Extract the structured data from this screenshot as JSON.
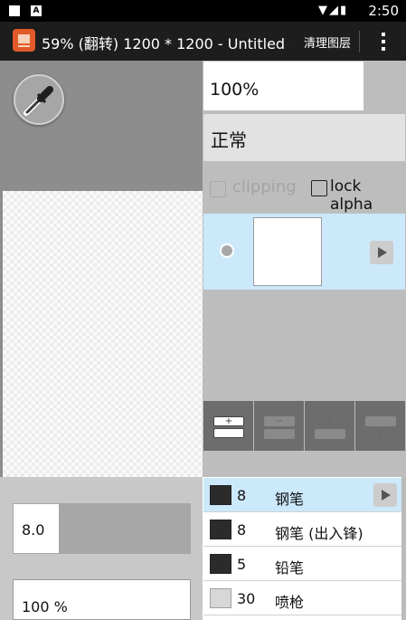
{
  "status_bar": {
    "time": "2:50",
    "notification_icon": "A",
    "icons": [
      "wifi-icon",
      "signal-icon",
      "battery-icon"
    ]
  },
  "app_bar": {
    "title": "59% (翻转) 1200 * 1200 - Untitled -...",
    "clear_layers_label": "清理图层",
    "menu_icon": "more-vert-icon"
  },
  "tools": {
    "eyedropper_icon": "eyedropper-icon"
  },
  "layer_panel": {
    "opacity": "100%",
    "blend_mode": "正常",
    "clipping_label": "clipping",
    "clipping_checked": false,
    "lock_alpha_label": "lock alpha",
    "lock_alpha_checked": false,
    "layers": [
      {
        "selected": true
      }
    ],
    "buttons": [
      {
        "name": "add-layer-button",
        "glyph": "+"
      },
      {
        "name": "delete-layer-button",
        "glyph": "−"
      },
      {
        "name": "move-layer-up-button",
        "glyph": "↑"
      },
      {
        "name": "move-layer-down-button",
        "glyph": "↓"
      }
    ]
  },
  "brush_settings": {
    "size": "8.0",
    "opacity": "100 %"
  },
  "brushes": [
    {
      "size": "8",
      "name": "钢笔",
      "selected": true,
      "swatch": "#2b2b2b"
    },
    {
      "size": "8",
      "name": "钢笔 (出入锋)",
      "selected": false,
      "swatch": "#2b2b2b"
    },
    {
      "size": "5",
      "name": "铅笔",
      "selected": false,
      "swatch": "#2b2b2b"
    },
    {
      "size": "30",
      "name": "喷枪",
      "selected": false,
      "swatch": "#d7d7d7"
    }
  ],
  "colors": {
    "accent_selection": "#cce8fb",
    "app_icon": "#e25a2a",
    "app_bar": "#1d1d1d"
  }
}
